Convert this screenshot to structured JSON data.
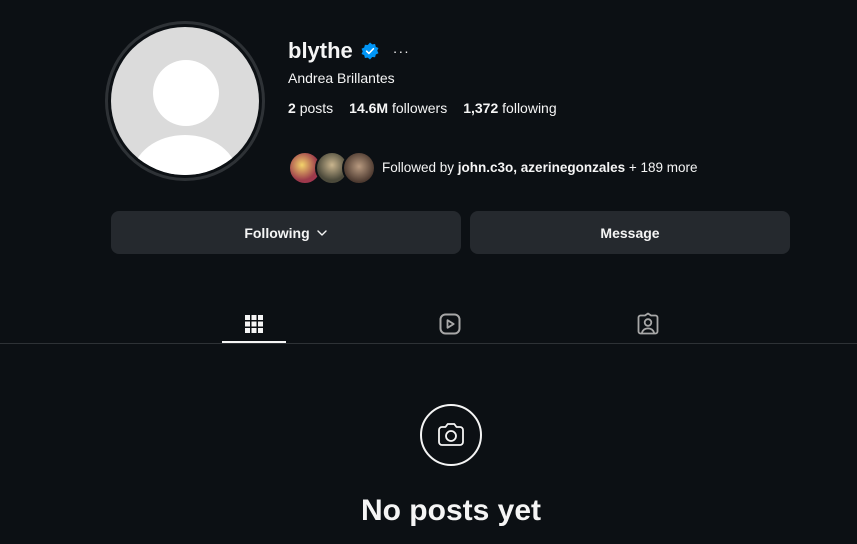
{
  "profile": {
    "username": "blythe",
    "full_name": "Andrea Brillantes",
    "verified": true,
    "more_label": "···"
  },
  "stats": {
    "posts_count": "2",
    "posts_label": "posts",
    "followers_count": "14.6M",
    "followers_label": "followers",
    "following_count": "1,372",
    "following_label": "following"
  },
  "followed_by": {
    "prefix": "Followed by ",
    "names": "john.c3o, azerinegonzales",
    "suffix": " + 189 more"
  },
  "actions": {
    "following_label": "Following",
    "message_label": "Message"
  },
  "tabs": [
    {
      "name": "posts",
      "icon": "grid-icon",
      "active": true
    },
    {
      "name": "reels",
      "icon": "reels-icon",
      "active": false
    },
    {
      "name": "tagged",
      "icon": "tagged-icon",
      "active": false
    }
  ],
  "empty_state": {
    "icon": "camera-icon",
    "title": "No posts yet"
  },
  "colors": {
    "background": "#0c1014",
    "button": "#25292e",
    "verified": "#0095f6",
    "text": "#f5f5f5"
  }
}
